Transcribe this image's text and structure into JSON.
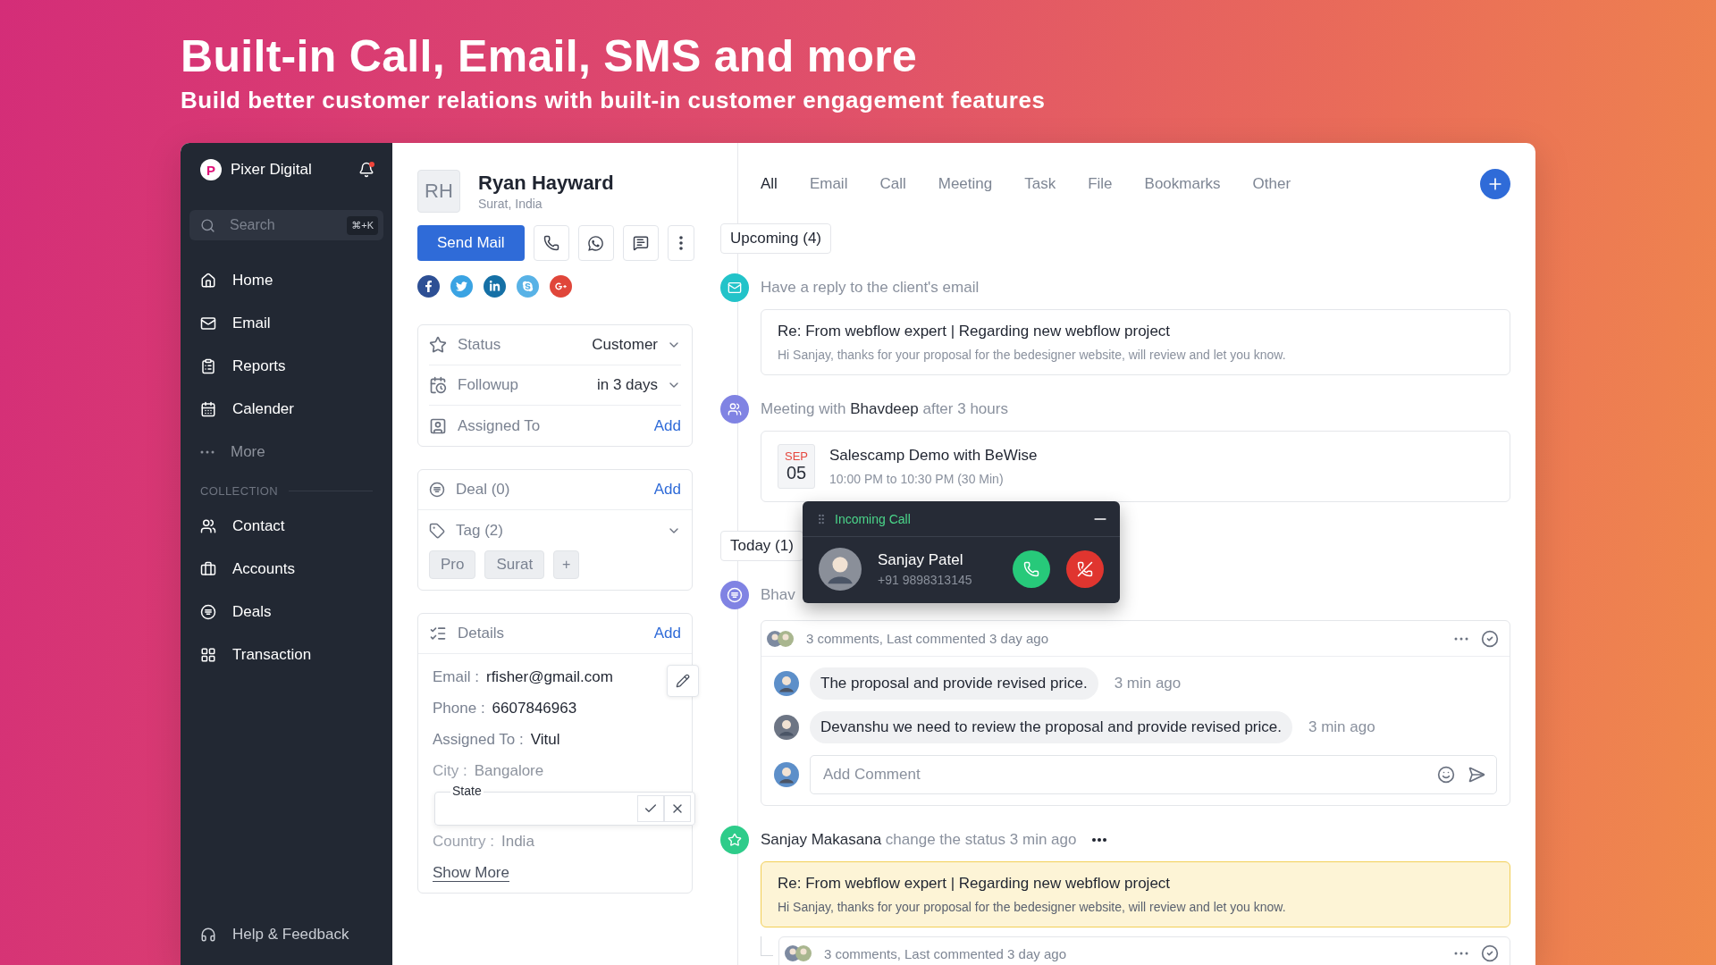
{
  "banner": {
    "title": "Built-in Call, Email, SMS and more",
    "subtitle": "Build better customer relations with built-in customer engagement features"
  },
  "sidebar": {
    "brand": "Pixer Digital",
    "logo_letter": "P",
    "search": {
      "placeholder": "Search",
      "shortcut": "⌘+K"
    },
    "nav": [
      "Home",
      "Email",
      "Reports",
      "Calender"
    ],
    "more": "More",
    "section": "COLLECTION",
    "collection": [
      "Contact",
      "Accounts",
      "Deals",
      "Transaction"
    ],
    "footer": "Help & Feedback"
  },
  "contact": {
    "initials": "RH",
    "name": "Ryan Hayward",
    "location": "Surat, India",
    "primary_action": "Send Mail"
  },
  "properties": [
    {
      "kind": "select",
      "label": "Status",
      "value": "Customer"
    },
    {
      "kind": "select",
      "label": "Followup",
      "value": "in 3 days"
    },
    {
      "kind": "action",
      "label": "Assigned To",
      "action": "Add"
    }
  ],
  "deal": {
    "label": "Deal (0)",
    "action": "Add"
  },
  "tags": {
    "label": "Tag (2)",
    "items": [
      "Pro",
      "Surat"
    ],
    "add": "+"
  },
  "details": {
    "label": "Details",
    "action": "Add",
    "fields": [
      {
        "kind": "text",
        "label": "Email :",
        "value": "rfisher@gmail.com",
        "faded": false
      },
      {
        "kind": "text",
        "label": "Phone :",
        "value": "6607846963",
        "faded": false
      },
      {
        "kind": "text",
        "label": "Assigned To :",
        "value": "Vitul",
        "faded": false
      },
      {
        "kind": "text",
        "label": "City :",
        "value": "Bangalore",
        "faded": true
      },
      {
        "kind": "editor",
        "label": "State"
      },
      {
        "kind": "text",
        "label": "Country :",
        "value": "India",
        "faded": true
      }
    ],
    "show_more": "Show More"
  },
  "timeline": {
    "tabs": [
      {
        "label": "All",
        "selected": true
      },
      {
        "label": "Email",
        "selected": false
      },
      {
        "label": "Call",
        "selected": false
      },
      {
        "label": "Meeting",
        "selected": false
      },
      {
        "label": "Task",
        "selected": false
      },
      {
        "label": "File",
        "selected": false
      },
      {
        "label": "Bookmarks",
        "selected": false
      },
      {
        "label": "Other",
        "selected": false
      }
    ],
    "groups": [
      {
        "label": "Upcoming (4)",
        "items": [
          {
            "kind": "email",
            "color": "#22c3c9",
            "heading": "Have a reply to the client's email",
            "title": "Re: From webflow expert | Regarding new webflow project",
            "body": "Hi Sanjay, thanks for your proposal for the bedesigner website, will review and let you know."
          },
          {
            "kind": "meeting",
            "color": "#8083e3",
            "heading": "Meeting with **Bhavdeep** after 3 hours",
            "month": "SEP",
            "day": "05",
            "title": "Salescamp Demo with BeWise",
            "time": "10:00 PM to 10:30 PM (30 Min)"
          }
        ]
      },
      {
        "label": "Today (1)",
        "items": [
          {
            "kind": "task",
            "color": "#8083e3",
            "heading": "Bhav",
            "thread": {
              "summary": "3 comments, Last commented 3 day ago",
              "comments": [
                {
                  "text": "The proposal and provide revised price.",
                  "time": "3 min ago"
                },
                {
                  "text": "Devanshu we need to review the proposal and provide revised price.",
                  "time": "3 min ago"
                }
              ],
              "input_placeholder": "Add Comment"
            }
          },
          {
            "kind": "status",
            "color": "#2ecc8a",
            "heading": "**Sanjay Makasana** change the status 3 min ago",
            "title": "Re: From webflow expert | Regarding new webflow project",
            "body": "Hi Sanjay, thanks for your proposal for the bedesigner website, will review and let you know.",
            "thread": {
              "summary": "3 comments, Last commented 3 day ago"
            }
          }
        ]
      }
    ],
    "incoming_call": {
      "title": "Incoming Call",
      "name": "Sanjay Patel",
      "phone": "+91 9898313145"
    }
  }
}
